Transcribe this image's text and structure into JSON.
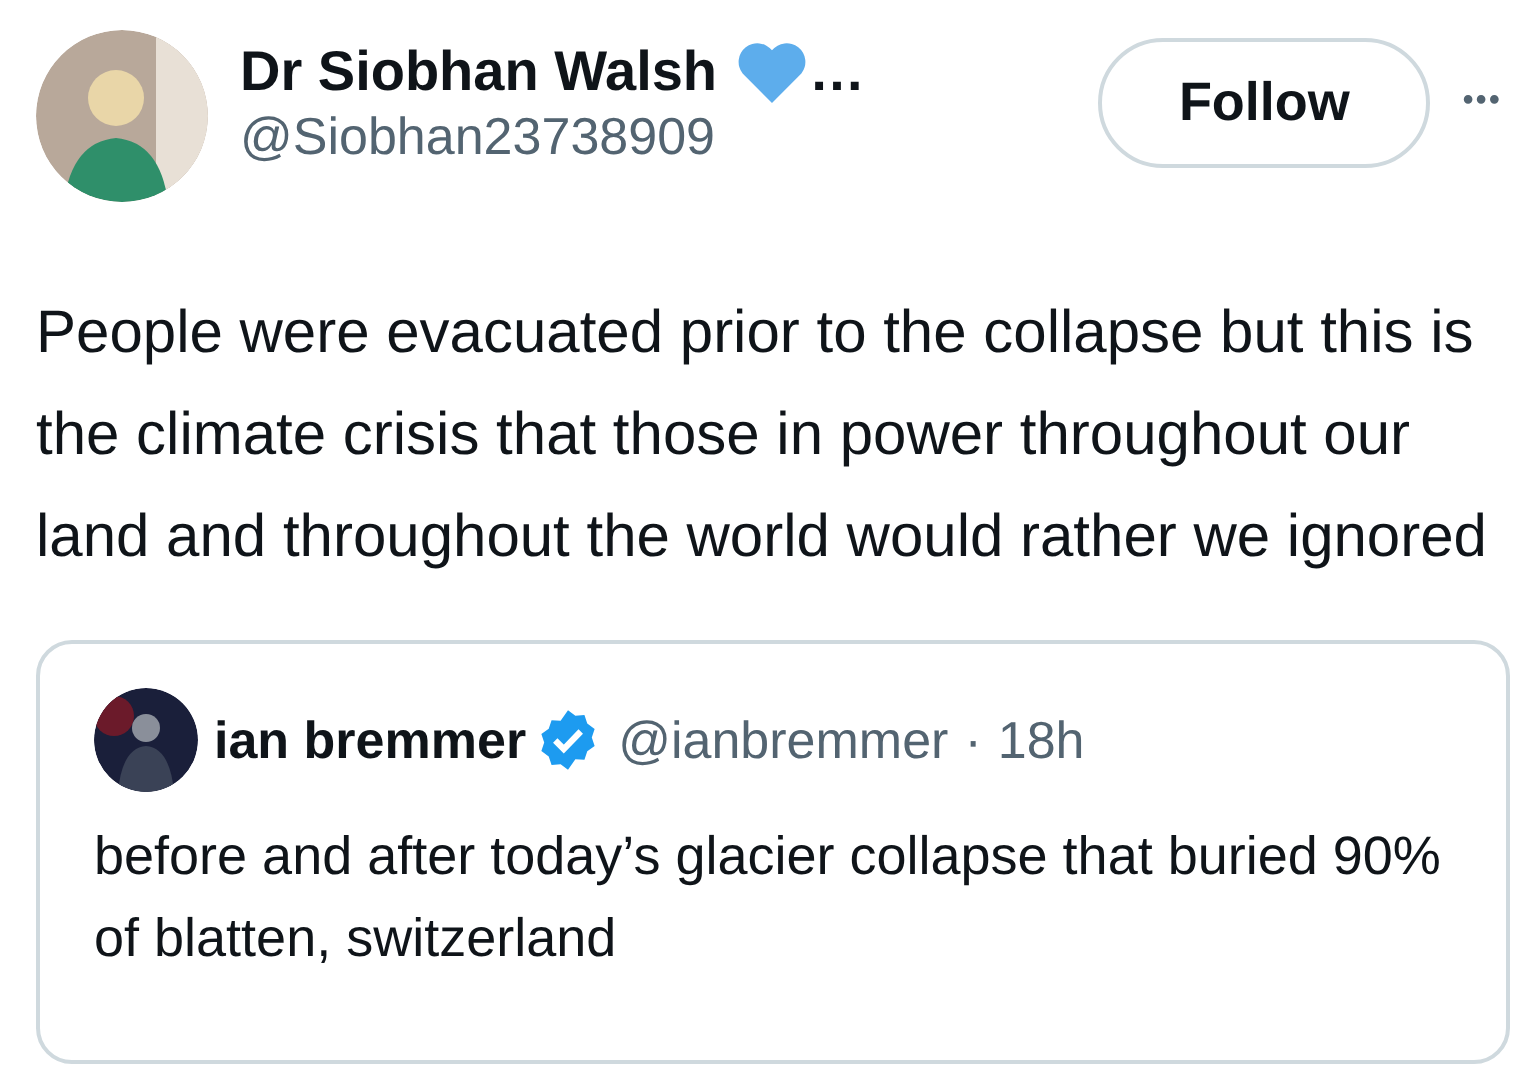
{
  "author": {
    "name": "Dr Siobhan Walsh",
    "truncation": "…",
    "handle": "@Siobhan23738909"
  },
  "follow_button": "Follow",
  "more_button": "•••",
  "text": "People were evacuated prior to the collapse but this is the climate crisis that those in power throughout our land and throughout the world would rather we ignored",
  "quoted": {
    "name": "ian bremmer",
    "verified": true,
    "handle": "@ianbremmer",
    "separator": "·",
    "time": "18h",
    "text": "before and after today’s glacier collapse that buried 90% of blatten, switzerland"
  }
}
